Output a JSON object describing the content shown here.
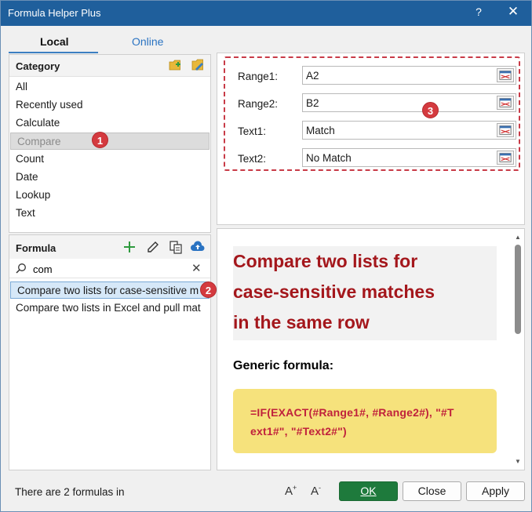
{
  "window": {
    "title": "Formula Helper Plus",
    "help_glyph": "?",
    "close_glyph": "✕"
  },
  "tabs": {
    "local": "Local",
    "online": "Online"
  },
  "category": {
    "header": "Category",
    "items": [
      "All",
      "Recently used",
      "Calculate",
      "Compare",
      "Count",
      "Date",
      "Lookup",
      "Text"
    ],
    "selected_index": 3
  },
  "formula": {
    "header": "Formula",
    "search_value": "com",
    "clear_glyph": "✕",
    "items": [
      "Compare two lists for case-sensitive m",
      "Compare two lists in Excel and pull mat"
    ],
    "selected_index": 0
  },
  "badges": {
    "one": "1",
    "two": "2",
    "three": "3"
  },
  "params": {
    "range1_label": "Range1:",
    "range1_value": "A2",
    "range2_label": "Range2:",
    "range2_value": "B2",
    "text1_label": "Text1:",
    "text1_value": "Match",
    "text2_label": "Text2:",
    "text2_value": "No Match"
  },
  "preview": {
    "title_line1": "Compare two lists for",
    "title_line2": "case-sensitive matches",
    "title_line3": "in the same row",
    "generic_label": "Generic formula:",
    "formula_line1": "=IF(EXACT(#Range1#, #Range2#), \"#T",
    "formula_line2": "ext1#\", \"#Text2#\")"
  },
  "status": {
    "text": "There are 2 formulas in"
  },
  "buttons": {
    "ok": "OK",
    "close": "Close",
    "apply": "Apply",
    "font_up": "A",
    "font_down": "A"
  },
  "colors": {
    "title_bar": "#1f5f9c",
    "accent_red": "#a4171c",
    "ok_green": "#1e7a3c",
    "badge_red": "#d43a3f",
    "formula_bg": "#f6e27c"
  }
}
